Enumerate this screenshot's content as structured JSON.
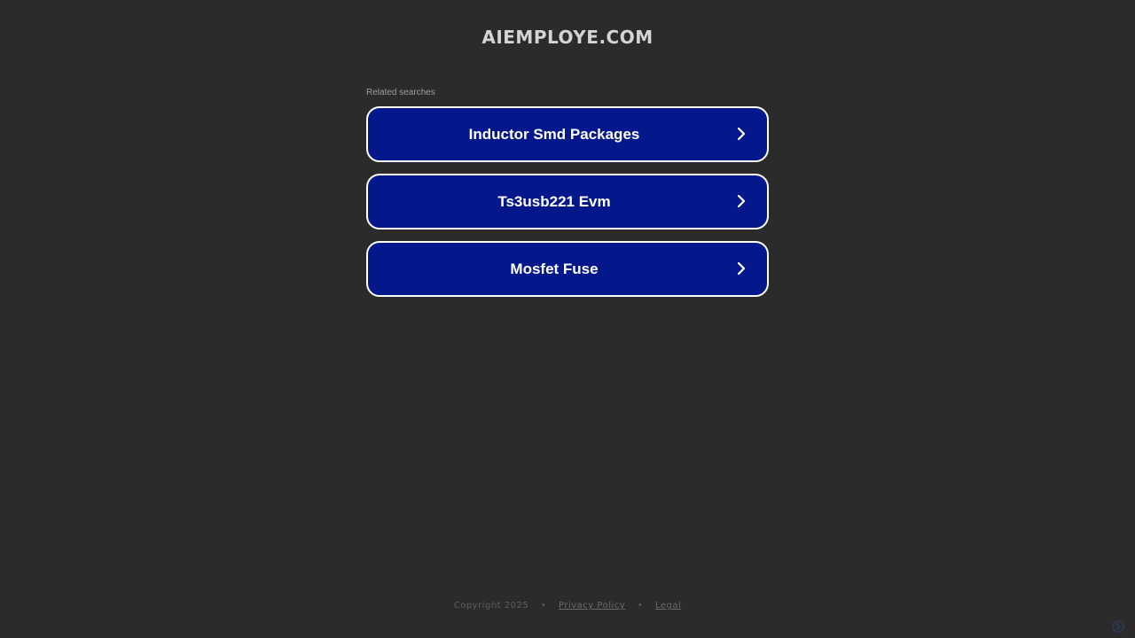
{
  "header": {
    "domain": "AIEMPLOYE.COM"
  },
  "related": {
    "label": "Related searches",
    "items": [
      {
        "label": "Inductor Smd Packages",
        "icon": "chevron-right-icon"
      },
      {
        "label": "Ts3usb221 Evm",
        "icon": "chevron-right-icon"
      },
      {
        "label": "Mosfet Fuse",
        "icon": "chevron-right-icon"
      }
    ]
  },
  "footer": {
    "copyright": "Copyright 2025",
    "separator": "•",
    "privacy": "Privacy Policy",
    "legal": "Legal"
  },
  "badge": {
    "label": "",
    "icon": "brand-logo-icon"
  },
  "colors": {
    "background": "#2b2b2b",
    "button_fill": "#04188c",
    "button_border": "#ffffff"
  }
}
